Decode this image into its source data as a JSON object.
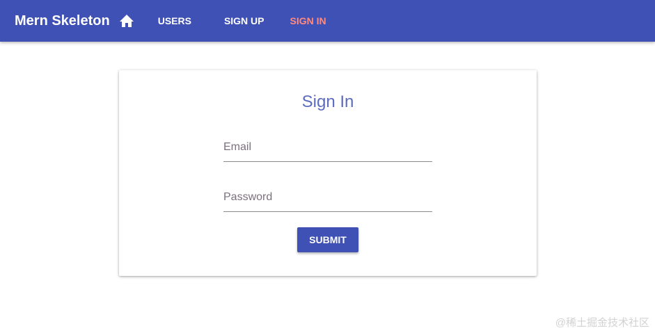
{
  "header": {
    "title": "Mern Skeleton",
    "home_icon": "home-icon",
    "nav": [
      {
        "label": "USERS",
        "color": "#ffffff"
      },
      {
        "label": "SIGN UP",
        "color": "#ffffff"
      },
      {
        "label": "SIGN IN",
        "color": "#ff8a80",
        "active": true
      }
    ],
    "background": "#3f51b5"
  },
  "card": {
    "title": "Sign In",
    "title_color": "#5c6bc0",
    "email": {
      "label": "Email",
      "value": ""
    },
    "password": {
      "label": "Password",
      "value": ""
    },
    "submit_label": "SUBMIT"
  },
  "watermark": "@稀土掘金技术社区"
}
